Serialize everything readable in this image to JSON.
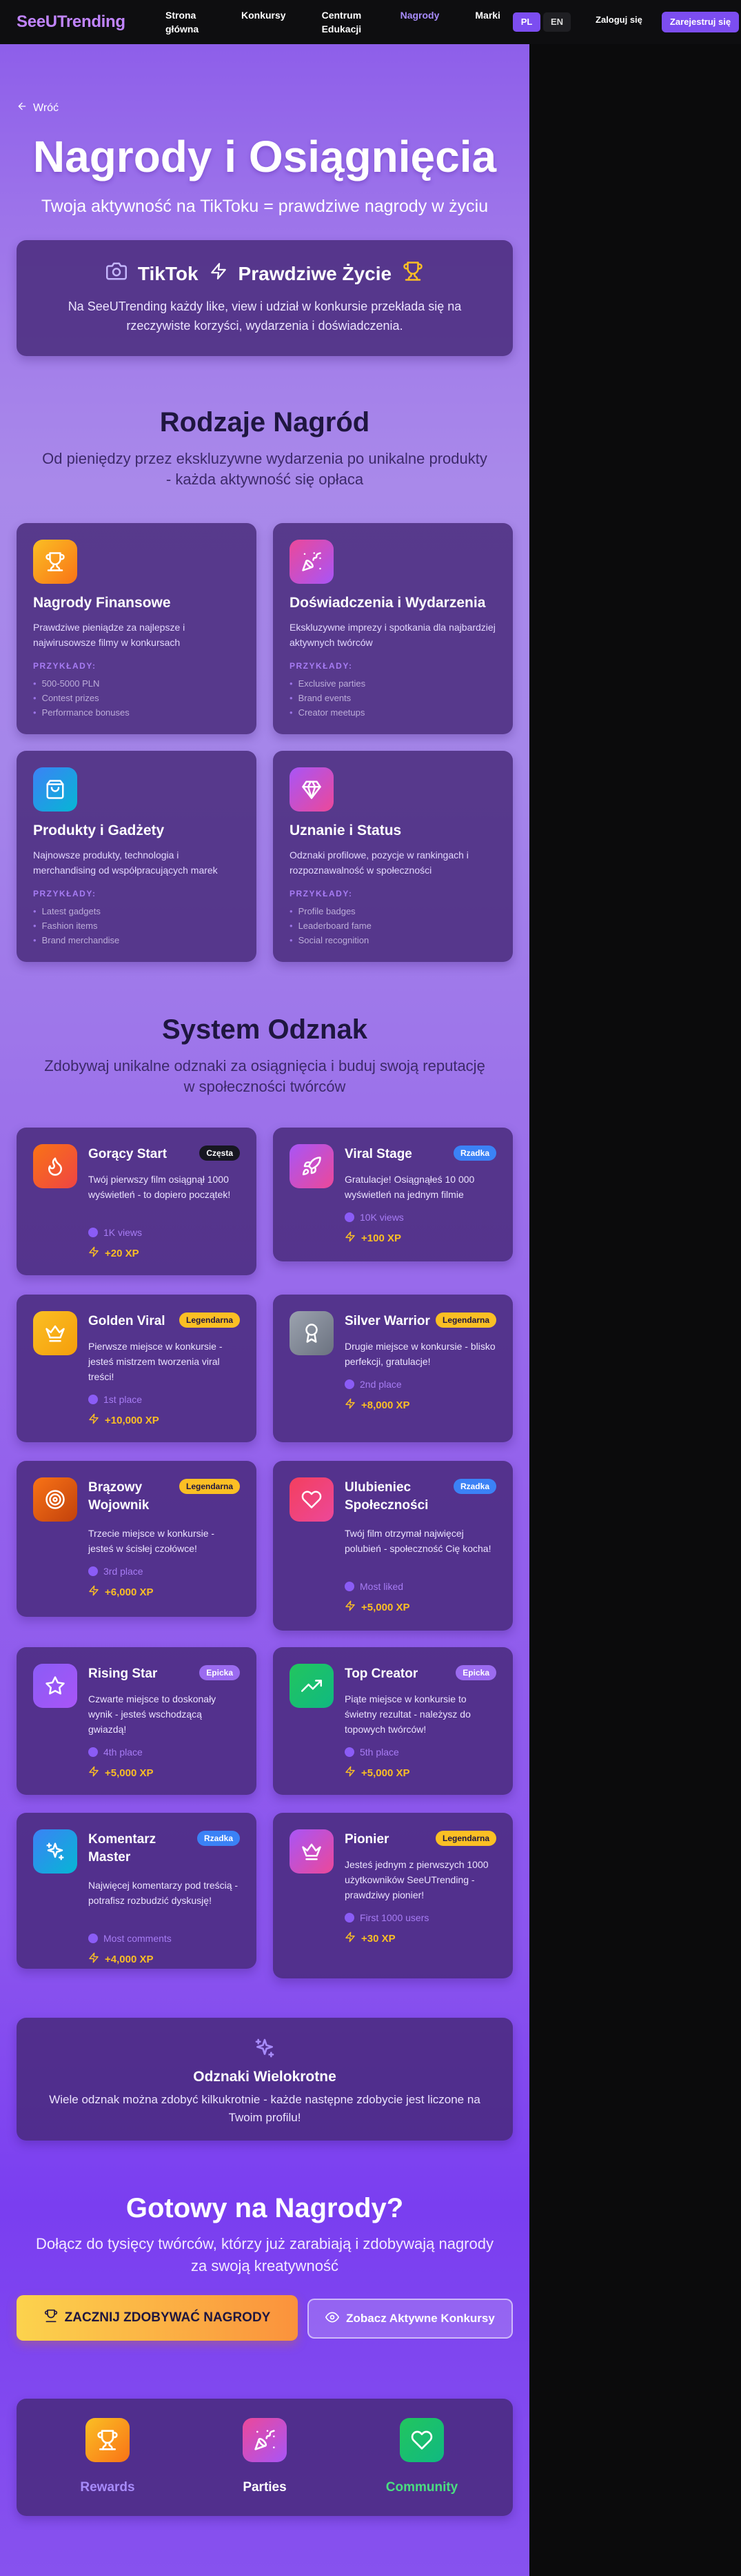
{
  "nav": {
    "logo": "SeeUTrending",
    "links": [
      "Strona główna",
      "Konkursy",
      "Centrum Edukacji",
      "Nagrody",
      "Marki"
    ],
    "lang": [
      "PL",
      "EN"
    ],
    "login": "Zaloguj się",
    "register": "Zarejestruj się"
  },
  "colors": {
    "accent": "#7c4df0",
    "active_link": "#a78bfa",
    "xp": "#fbbf24"
  },
  "header": {
    "back": "Wróć",
    "title": "Nagrody i Osiągnięcia",
    "subtitle": "Twoja aktywność na TikToku = prawdziwe nagrody w życiu"
  },
  "intro": {
    "left": "TikTok",
    "right": "Prawdziwe Życie",
    "text": "Na SeeUTrending każdy like, view i udział w konkursie przekłada się na rzeczywiste korzyści, wydarzenia i doświadczenia."
  },
  "rewards": {
    "title": "Rodzaje Nagród",
    "subtitle": "Od pieniędzy przez ekskluzywne wydarzenia po unikalne produkty - każda aktywność się opłaca",
    "examples_label": "PRZYKŁADY:",
    "items": [
      {
        "icon": "trophy-icon",
        "title": "Nagrody Finansowe",
        "desc": "Prawdziwe pieniądze za najlepsze i najwirusowsze filmy w konkursach",
        "examples": [
          "500-5000 PLN",
          "Contest prizes",
          "Performance bonuses"
        ]
      },
      {
        "icon": "party-popper-icon",
        "title": "Doświadczenia i Wydarzenia",
        "desc": "Ekskluzywne imprezy i spotkania dla najbardziej aktywnych twórców",
        "examples": [
          "Exclusive parties",
          "Brand events",
          "Creator meetups"
        ]
      },
      {
        "icon": "shopping-bag-icon",
        "title": "Produkty i Gadżety",
        "desc": "Najnowsze produkty, technologia i merchandising od współpracujących marek",
        "examples": [
          "Latest gadgets",
          "Fashion items",
          "Brand merchandise"
        ]
      },
      {
        "icon": "diamond-icon",
        "title": "Uznanie i Status",
        "desc": "Odznaki profilowe, pozycje w rankingach i rozpoznawalność w społeczności",
        "examples": [
          "Profile badges",
          "Leaderboard fame",
          "Social recognition"
        ]
      }
    ]
  },
  "badges": {
    "title": "System Odznak",
    "subtitle": "Zdobywaj unikalne odznaki za osiągnięcia i buduj swoją reputację w społeczności twórców",
    "items": [
      {
        "icon": "flame-icon",
        "title": "Gorący Start",
        "rarity": "Częsta",
        "desc": "Twój pierwszy film osiągnął 1000 wyświetleń - to dopiero początek!",
        "meta": "1K views",
        "xp": "+20 XP"
      },
      {
        "icon": "rocket-icon",
        "title": "Viral Stage",
        "rarity": "Rzadka",
        "desc": "Gratulacje! Osiągnąłeś 10 000 wyświetleń na jednym filmie",
        "meta": "10K views",
        "xp": "+100 XP"
      },
      {
        "icon": "crown-icon",
        "title": "Golden Viral",
        "rarity": "Legendarna",
        "desc": "Pierwsze miejsce w konkursie - jesteś mistrzem tworzenia viral treści!",
        "meta": "1st place",
        "xp": "+10,000 XP"
      },
      {
        "icon": "award-icon",
        "title": "Silver Warrior",
        "rarity": "Legendarna",
        "desc": "Drugie miejsce w konkursie - blisko perfekcji, gratulacje!",
        "meta": "2nd place",
        "xp": "+8,000 XP"
      },
      {
        "icon": "target-icon",
        "title": "Brązowy Wojownik",
        "rarity": "Legendarna",
        "desc": "Trzecie miejsce w konkursie - jesteś w ścisłej czołówce!",
        "meta": "3rd place",
        "xp": "+6,000 XP"
      },
      {
        "icon": "heart-icon",
        "title": "Ulubieniec Społeczności",
        "rarity": "Rzadka",
        "desc": "Twój film otrzymał najwięcej polubień - społeczność Cię kocha!",
        "meta": "Most liked",
        "xp": "+5,000 XP"
      },
      {
        "icon": "star-icon",
        "title": "Rising Star",
        "rarity": "Epicka",
        "desc": "Czwarte miejsce to doskonały wynik - jesteś wschodzącą gwiazdą!",
        "meta": "4th place",
        "xp": "+5,000 XP"
      },
      {
        "icon": "trending-up-icon",
        "title": "Top Creator",
        "rarity": "Epicka",
        "desc": "Piąte miejsce w konkursie to świetny rezultat - należysz do topowych twórców!",
        "meta": "5th place",
        "xp": "+5,000 XP"
      },
      {
        "icon": "sparkles-icon",
        "title": "Komentarz Master",
        "rarity": "Rzadka",
        "desc": "Najwięcej komentarzy pod treścią - potrafisz rozbudzić dyskusję!",
        "meta": "Most comments",
        "xp": "+4,000 XP"
      },
      {
        "icon": "crown-icon",
        "title": "Pionier",
        "rarity": "Legendarna",
        "desc": "Jesteś jednym z pierwszych 1000 użytkowników SeeUTrending - prawdziwy pionier!",
        "meta": "First 1000 users",
        "xp": "+30 XP"
      }
    ]
  },
  "multi": {
    "title": "Odznaki Wielokrotne",
    "text": "Wiele odznak można zdobyć kilkukrotnie - każde następne zdobycie jest liczone na Twoim profilu!"
  },
  "cta": {
    "title": "Gotowy na Nagrody?",
    "subtitle": "Dołącz do tysięcy twórców, którzy już zarabiają i zdobywają nagrody za swoją kreatywność",
    "primary": "ZACZNIJ ZDOBYWAĆ NAGRODY",
    "secondary": "Zobacz Aktywne Konkursy"
  },
  "footer": {
    "items": [
      {
        "icon": "trophy-icon",
        "label": "Rewards"
      },
      {
        "icon": "party-popper-icon",
        "label": "Parties"
      },
      {
        "icon": "heart-icon",
        "label": "Community"
      }
    ]
  }
}
